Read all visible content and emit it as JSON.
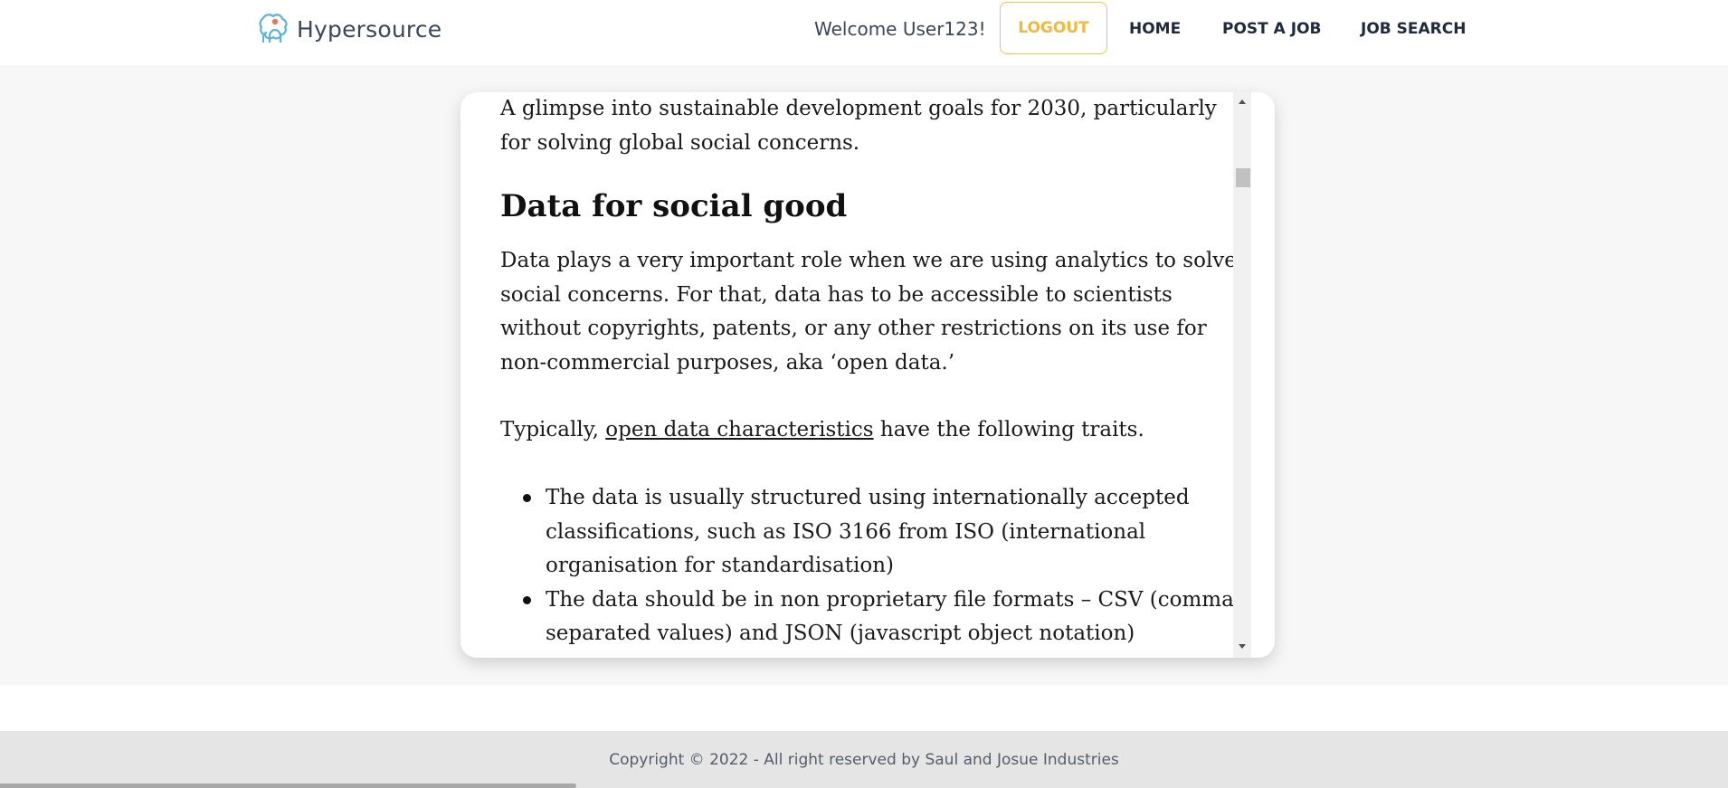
{
  "header": {
    "brand": "Hypersource",
    "welcome": "Welcome User123!",
    "nav": {
      "logout": "LOGOUT",
      "home": "HOME",
      "post_job": "POST A JOB",
      "job_search": "JOB SEARCH"
    }
  },
  "article": {
    "intro": "A glimpse into sustainable development goals for 2030, particularly for solving global social concerns.",
    "heading": "Data for social good",
    "paragraph1": "Data plays a very important role when we are using analytics to solve social concerns. For that, data has to be accessible to scientists without copyrights, patents, or any other restrictions on its use for non-commercial purposes, aka ‘open data.’",
    "paragraph2_before": "Typically, ",
    "paragraph2_link": "open data characteristics",
    "paragraph2_after": " have the following traits.",
    "bullets": [
      "The data is usually structured using internationally accepted classifications, such as ISO 3166 from ISO (international organisation for standardisation)",
      "The data should be in non proprietary file formats – CSV (comma-separated values) and JSON (javascript object notation)"
    ]
  },
  "footer": {
    "copyright": "Copyright © 2022 - All right reserved by Saul and Josue Industries"
  }
}
